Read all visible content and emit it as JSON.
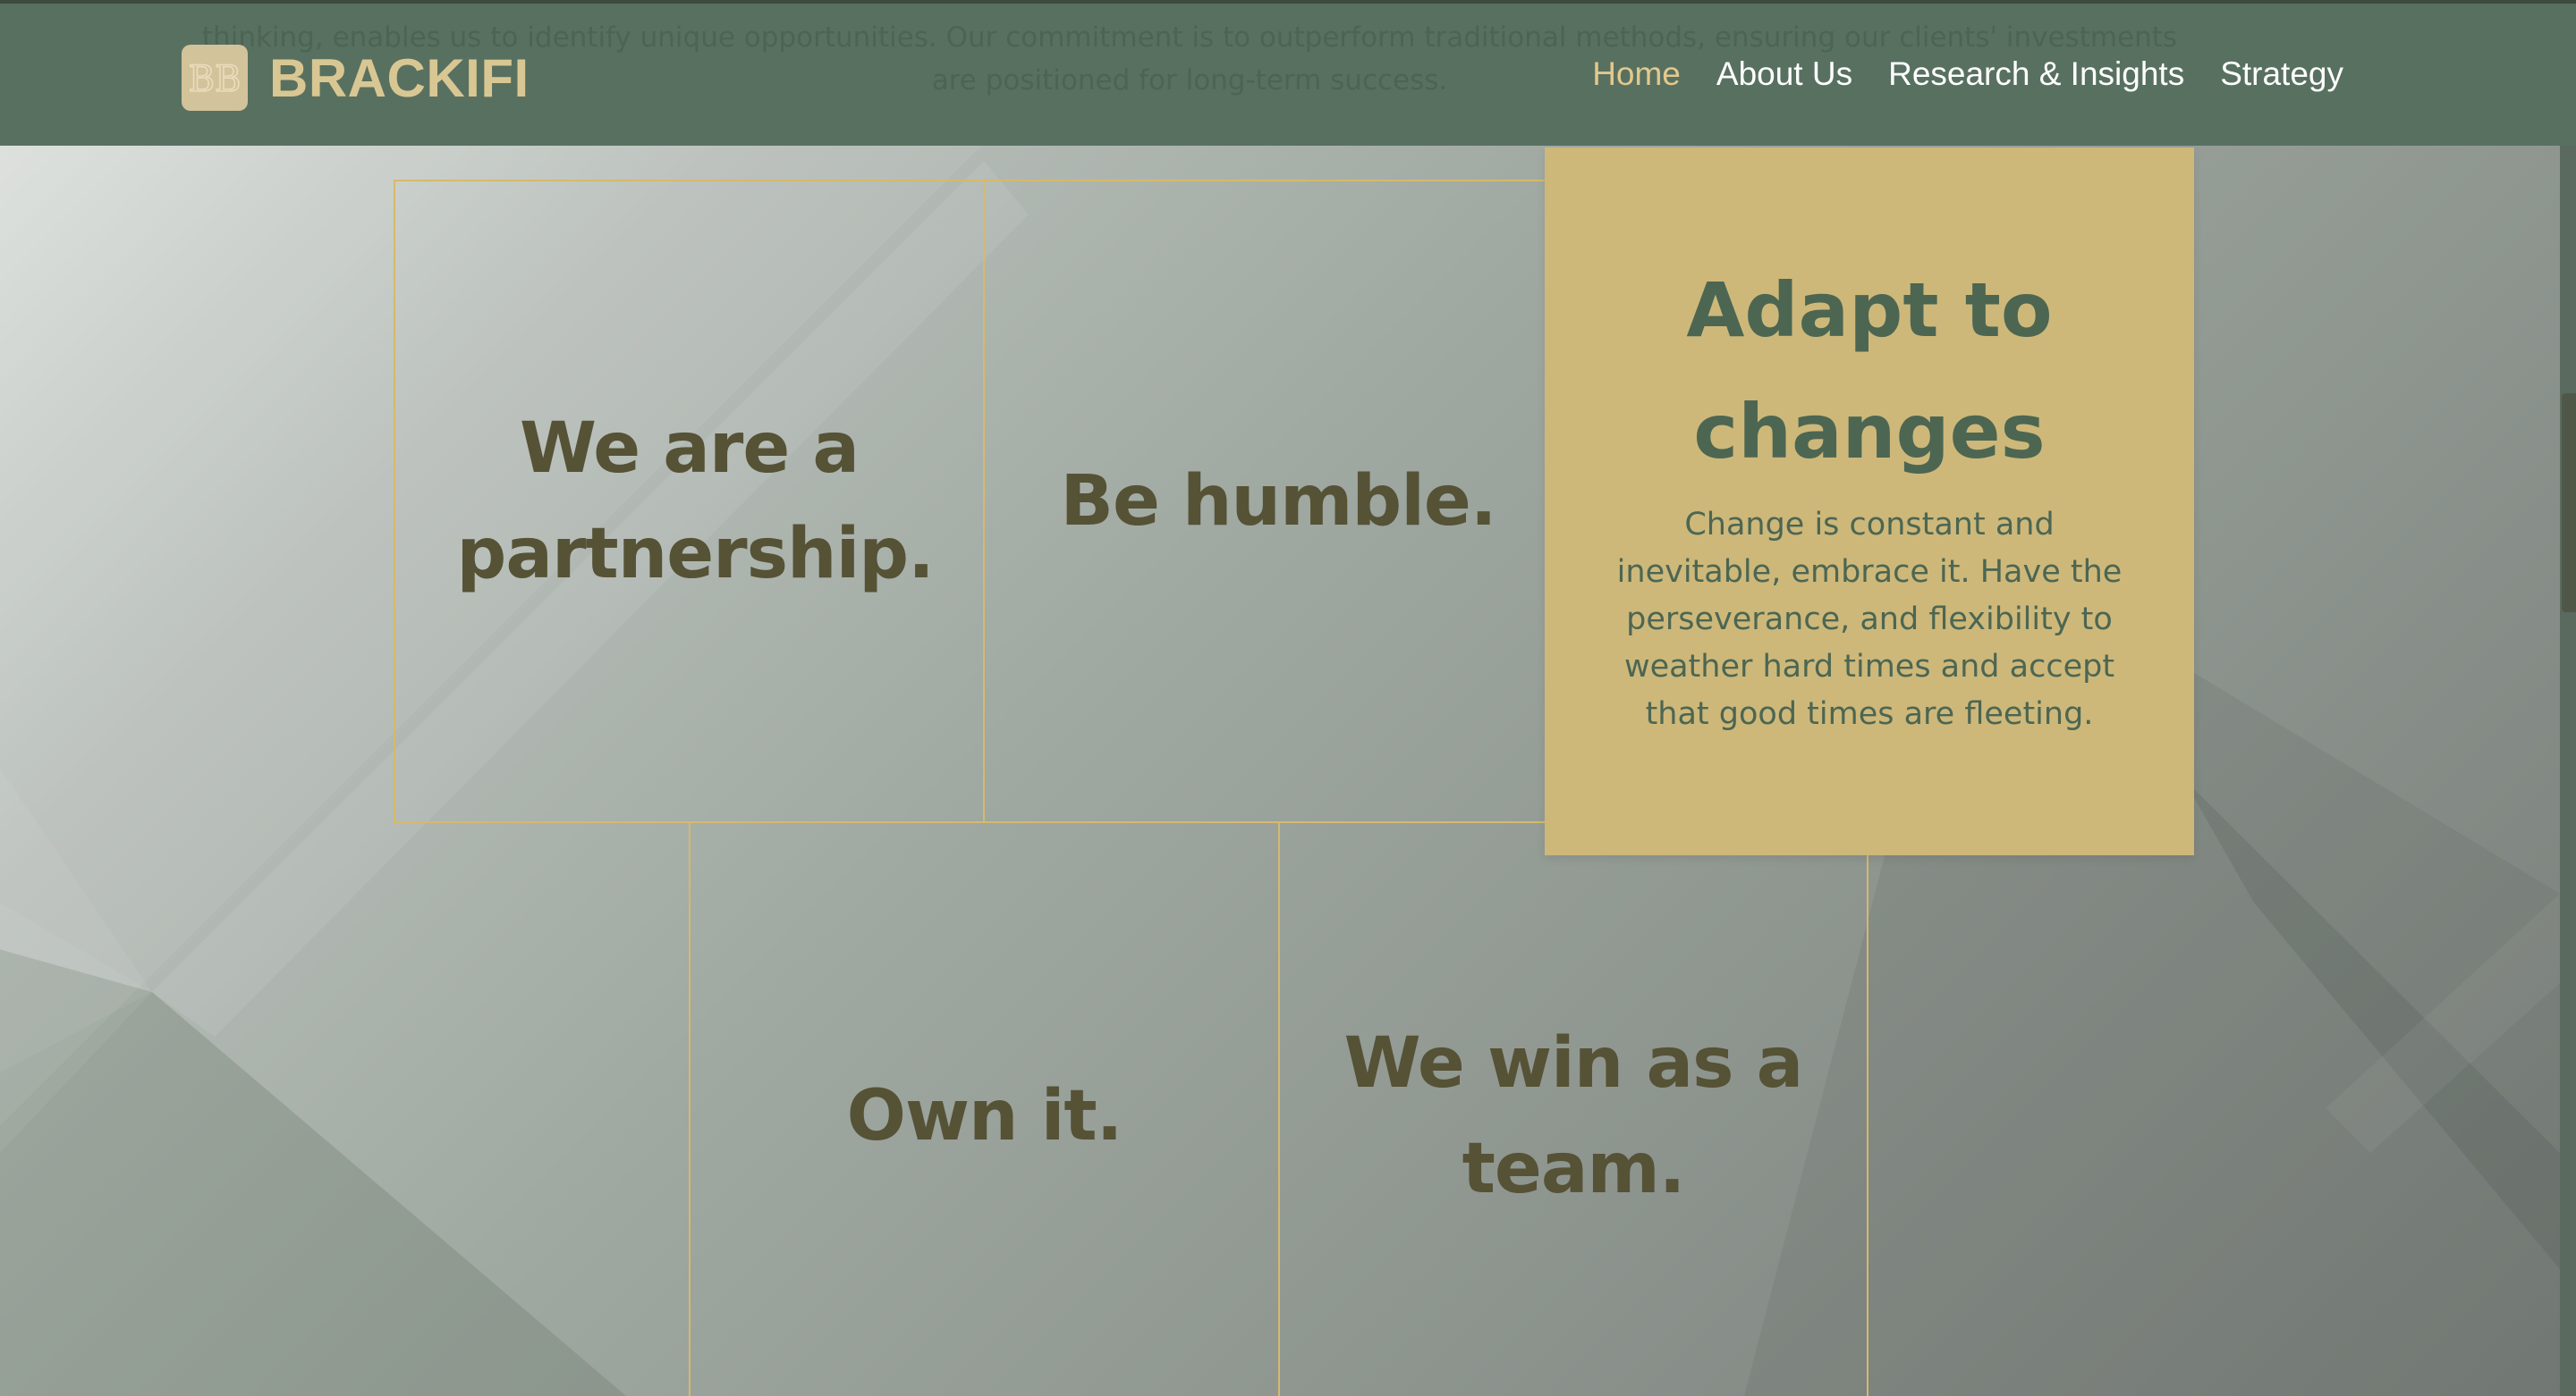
{
  "header": {
    "ghost_text": "thinking, enables us to identify unique opportunities. Our commitment is to outperform traditional methods, ensuring our clients' investments are positioned for long-term success.",
    "brand": {
      "name": "BRACKIFI",
      "mark": "BB"
    },
    "nav": [
      {
        "label": "Home",
        "active": true
      },
      {
        "label": "About Us",
        "active": false
      },
      {
        "label": "Research & Insights",
        "active": false
      },
      {
        "label": "Strategy",
        "active": false
      }
    ]
  },
  "values": {
    "tiles": [
      {
        "title": "We are a partnership."
      },
      {
        "title": "Be humble."
      },
      {
        "title": "Own it."
      },
      {
        "title": "We win as a team."
      }
    ],
    "feature": {
      "title": "Adapt to changes",
      "body": "Change is constant and inevitable, embrace it. Have the perseverance, and flexibility to weather hard times and accept that good times are fleeting."
    }
  },
  "colors": {
    "header_bg": "#587060",
    "brand_gold": "#d9c793",
    "nav_active": "#e3c98d",
    "tile_border": "#d5b96e",
    "tile_text": "#555236",
    "feature_bg": "#cdb87a",
    "feature_text": "#4c6652"
  }
}
